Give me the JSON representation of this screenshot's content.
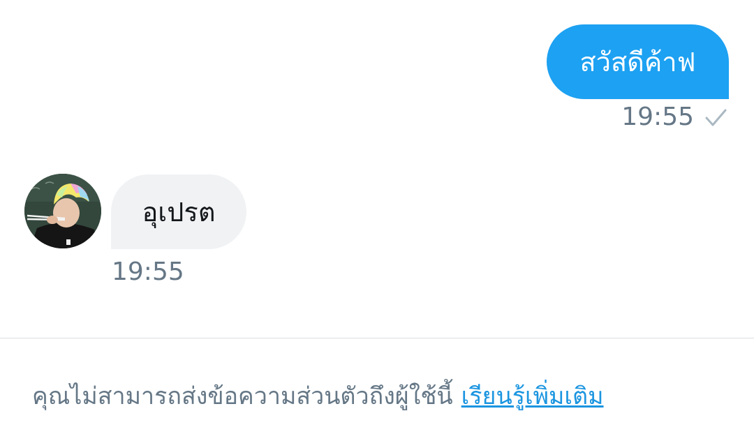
{
  "conversation": {
    "outgoing": {
      "text": "สวัสดีค้าฟ",
      "time": "19:55",
      "status_icon": "check-icon"
    },
    "incoming": {
      "text": "อุเปรต",
      "time": "19:55",
      "avatar_icon": "avatar"
    }
  },
  "footer": {
    "notice_text": "คุณไม่สามารถส่งข้อความส่วนตัวถึงผู้ใช้นี้",
    "link_text": "เรียนรู้เพิ่มเติม"
  },
  "colors": {
    "outgoing_bubble": "#1da1f2",
    "incoming_bubble": "#f0f2f4",
    "meta_text": "#657786",
    "link": "#1b95e0"
  }
}
